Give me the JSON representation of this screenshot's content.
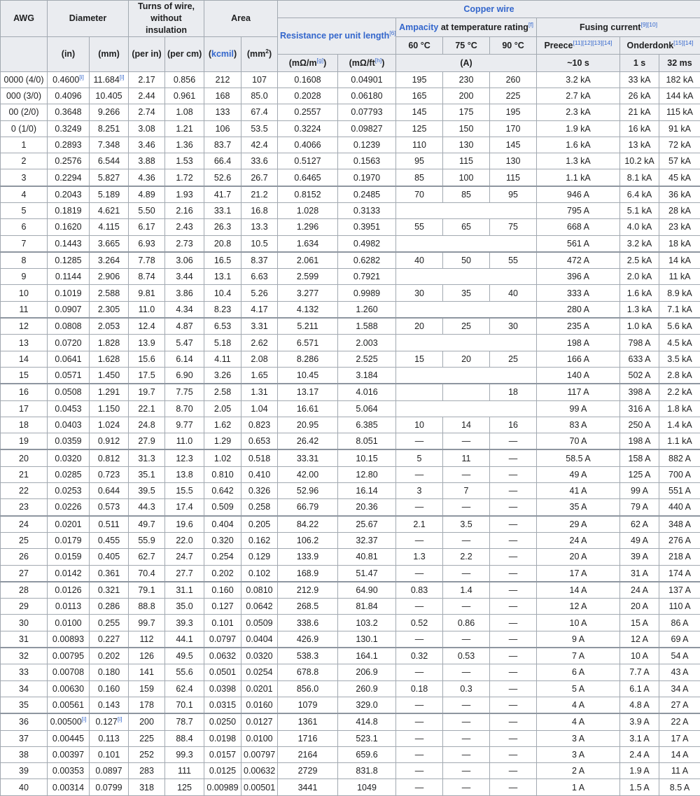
{
  "header": {
    "awg": "AWG",
    "diameter": "Diameter",
    "turns": "Turns of wire, without insulation",
    "area": "Area",
    "copper_wire": "Copper wire",
    "resistance": "Resistance per unit length",
    "resistance_ref": "[6]",
    "ampacity_link": "Ampacity",
    "ampacity_rest": " at temperature rating",
    "ampacity_ref": "[f]",
    "fusing": "Fusing current",
    "fusing_ref": "[9][10]",
    "t60": "60 °C",
    "t75": "75 °C",
    "t90": "90 °C",
    "preece": "Preece",
    "preece_ref": "[11][12][13][14]",
    "onderdonk": "Onderdonk",
    "onderdonk_ref": "[15][14]",
    "u_in": "(in)",
    "u_mm": "(mm)",
    "u_per_in": "(per in)",
    "u_per_cm": "(per cm)",
    "u_kcmil_open": "(",
    "u_kcmil": "kcmil",
    "u_kcmil_close": ")",
    "u_mm2_base": "(mm",
    "u_mm2_sup": "2",
    "u_mm2_close": ")",
    "u_mohm_m": "(mΩ/m",
    "u_mohm_m_ref": "[g]",
    "u_mohm_ft": "(mΩ/ft",
    "u_mohm_ft_ref": "[h]",
    "u_amp": "(A)",
    "u_10s": "~10 s",
    "u_1s": "1 s",
    "u_32ms": "32 ms",
    "close_paren": ")"
  },
  "rows": [
    {
      "awg": "0000 (4/0)",
      "din": "0.4600",
      "din_ref": "[i]",
      "dmm": "11.684",
      "dmm_ref": "[i]",
      "tin": "2.17",
      "tcm": "0.856",
      "kcmil": "212",
      "mm2": "107",
      "rm": "0.1608",
      "rft": "0.04901",
      "amp": [
        "195",
        "230",
        "260"
      ],
      "preece": "3.2 kA",
      "o1": "33 kA",
      "o32": "182 kA"
    },
    {
      "awg": "000 (3/0)",
      "din": "0.4096",
      "dmm": "10.405",
      "tin": "2.44",
      "tcm": "0.961",
      "kcmil": "168",
      "mm2": "85.0",
      "rm": "0.2028",
      "rft": "0.06180",
      "amp": [
        "165",
        "200",
        "225"
      ],
      "preece": "2.7 kA",
      "o1": "26 kA",
      "o32": "144 kA"
    },
    {
      "awg": "00 (2/0)",
      "din": "0.3648",
      "dmm": "9.266",
      "tin": "2.74",
      "tcm": "1.08",
      "kcmil": "133",
      "mm2": "67.4",
      "rm": "0.2557",
      "rft": "0.07793",
      "amp": [
        "145",
        "175",
        "195"
      ],
      "preece": "2.3 kA",
      "o1": "21 kA",
      "o32": "115 kA"
    },
    {
      "awg": "0 (1/0)",
      "din": "0.3249",
      "dmm": "8.251",
      "tin": "3.08",
      "tcm": "1.21",
      "kcmil": "106",
      "mm2": "53.5",
      "rm": "0.3224",
      "rft": "0.09827",
      "amp": [
        "125",
        "150",
        "170"
      ],
      "preece": "1.9 kA",
      "o1": "16 kA",
      "o32": "91 kA"
    },
    {
      "awg": "1",
      "din": "0.2893",
      "dmm": "7.348",
      "tin": "3.46",
      "tcm": "1.36",
      "kcmil": "83.7",
      "mm2": "42.4",
      "rm": "0.4066",
      "rft": "0.1239",
      "amp": [
        "110",
        "130",
        "145"
      ],
      "preece": "1.6 kA",
      "o1": "13 kA",
      "o32": "72 kA"
    },
    {
      "awg": "2",
      "din": "0.2576",
      "dmm": "6.544",
      "tin": "3.88",
      "tcm": "1.53",
      "kcmil": "66.4",
      "mm2": "33.6",
      "rm": "0.5127",
      "rft": "0.1563",
      "amp": [
        "95",
        "115",
        "130"
      ],
      "preece": "1.3 kA",
      "o1": "10.2 kA",
      "o32": "57 kA"
    },
    {
      "awg": "3",
      "din": "0.2294",
      "dmm": "5.827",
      "tin": "4.36",
      "tcm": "1.72",
      "kcmil": "52.6",
      "mm2": "26.7",
      "rm": "0.6465",
      "rft": "0.1970",
      "amp": [
        "85",
        "100",
        "115"
      ],
      "preece": "1.1 kA",
      "o1": "8.1 kA",
      "o32": "45 kA"
    },
    {
      "awg": "4",
      "din": "0.2043",
      "dmm": "5.189",
      "tin": "4.89",
      "tcm": "1.93",
      "kcmil": "41.7",
      "mm2": "21.2",
      "rm": "0.8152",
      "rft": "0.2485",
      "amp": [
        "70",
        "85",
        "95"
      ],
      "preece": "946 A",
      "o1": "6.4 kA",
      "o32": "36 kA"
    },
    {
      "awg": "5",
      "din": "0.1819",
      "dmm": "4.621",
      "tin": "5.50",
      "tcm": "2.16",
      "kcmil": "33.1",
      "mm2": "16.8",
      "rm": "1.028",
      "rft": "0.3133",
      "amp": null,
      "preece": "795 A",
      "o1": "5.1 kA",
      "o32": "28 kA"
    },
    {
      "awg": "6",
      "din": "0.1620",
      "dmm": "4.115",
      "tin": "6.17",
      "tcm": "2.43",
      "kcmil": "26.3",
      "mm2": "13.3",
      "rm": "1.296",
      "rft": "0.3951",
      "amp": [
        "55",
        "65",
        "75"
      ],
      "preece": "668 A",
      "o1": "4.0 kA",
      "o32": "23 kA"
    },
    {
      "awg": "7",
      "din": "0.1443",
      "dmm": "3.665",
      "tin": "6.93",
      "tcm": "2.73",
      "kcmil": "20.8",
      "mm2": "10.5",
      "rm": "1.634",
      "rft": "0.4982",
      "amp": null,
      "preece": "561 A",
      "o1": "3.2 kA",
      "o32": "18 kA"
    },
    {
      "awg": "8",
      "din": "0.1285",
      "dmm": "3.264",
      "tin": "7.78",
      "tcm": "3.06",
      "kcmil": "16.5",
      "mm2": "8.37",
      "rm": "2.061",
      "rft": "0.6282",
      "amp": [
        "40",
        "50",
        "55"
      ],
      "preece": "472 A",
      "o1": "2.5 kA",
      "o32": "14 kA"
    },
    {
      "awg": "9",
      "din": "0.1144",
      "dmm": "2.906",
      "tin": "8.74",
      "tcm": "3.44",
      "kcmil": "13.1",
      "mm2": "6.63",
      "rm": "2.599",
      "rft": "0.7921",
      "amp": null,
      "preece": "396 A",
      "o1": "2.0 kA",
      "o32": "11 kA"
    },
    {
      "awg": "10",
      "din": "0.1019",
      "dmm": "2.588",
      "tin": "9.81",
      "tcm": "3.86",
      "kcmil": "10.4",
      "mm2": "5.26",
      "rm": "3.277",
      "rft": "0.9989",
      "amp": [
        "30",
        "35",
        "40"
      ],
      "preece": "333 A",
      "o1": "1.6 kA",
      "o32": "8.9 kA"
    },
    {
      "awg": "11",
      "din": "0.0907",
      "dmm": "2.305",
      "tin": "11.0",
      "tcm": "4.34",
      "kcmil": "8.23",
      "mm2": "4.17",
      "rm": "4.132",
      "rft": "1.260",
      "amp": null,
      "preece": "280 A",
      "o1": "1.3 kA",
      "o32": "7.1 kA"
    },
    {
      "awg": "12",
      "din": "0.0808",
      "dmm": "2.053",
      "tin": "12.4",
      "tcm": "4.87",
      "kcmil": "6.53",
      "mm2": "3.31",
      "rm": "5.211",
      "rft": "1.588",
      "amp": [
        "20",
        "25",
        "30"
      ],
      "preece": "235 A",
      "o1": "1.0 kA",
      "o32": "5.6 kA"
    },
    {
      "awg": "13",
      "din": "0.0720",
      "dmm": "1.828",
      "tin": "13.9",
      "tcm": "5.47",
      "kcmil": "5.18",
      "mm2": "2.62",
      "rm": "6.571",
      "rft": "2.003",
      "amp": null,
      "preece": "198 A",
      "o1": "798 A",
      "o32": "4.5 kA"
    },
    {
      "awg": "14",
      "din": "0.0641",
      "dmm": "1.628",
      "tin": "15.6",
      "tcm": "6.14",
      "kcmil": "4.11",
      "mm2": "2.08",
      "rm": "8.286",
      "rft": "2.525",
      "amp": [
        "15",
        "20",
        "25"
      ],
      "preece": "166 A",
      "o1": "633 A",
      "o32": "3.5 kA"
    },
    {
      "awg": "15",
      "din": "0.0571",
      "dmm": "1.450",
      "tin": "17.5",
      "tcm": "6.90",
      "kcmil": "3.26",
      "mm2": "1.65",
      "rm": "10.45",
      "rft": "3.184",
      "amp": null,
      "preece": "140 A",
      "o1": "502 A",
      "o32": "2.8 kA"
    },
    {
      "awg": "16",
      "din": "0.0508",
      "dmm": "1.291",
      "tin": "19.7",
      "tcm": "7.75",
      "kcmil": "2.58",
      "mm2": "1.31",
      "rm": "13.17",
      "rft": "4.016",
      "amp": [
        "",
        "",
        "18"
      ],
      "preece": "117 A",
      "o1": "398 A",
      "o32": "2.2 kA"
    },
    {
      "awg": "17",
      "din": "0.0453",
      "dmm": "1.150",
      "tin": "22.1",
      "tcm": "8.70",
      "kcmil": "2.05",
      "mm2": "1.04",
      "rm": "16.61",
      "rft": "5.064",
      "amp": null,
      "preece": "99 A",
      "o1": "316 A",
      "o32": "1.8 kA"
    },
    {
      "awg": "18",
      "din": "0.0403",
      "dmm": "1.024",
      "tin": "24.8",
      "tcm": "9.77",
      "kcmil": "1.62",
      "mm2": "0.823",
      "rm": "20.95",
      "rft": "6.385",
      "amp": [
        "10",
        "14",
        "16"
      ],
      "preece": "83 A",
      "o1": "250 A",
      "o32": "1.4 kA"
    },
    {
      "awg": "19",
      "din": "0.0359",
      "dmm": "0.912",
      "tin": "27.9",
      "tcm": "11.0",
      "kcmil": "1.29",
      "mm2": "0.653",
      "rm": "26.42",
      "rft": "8.051",
      "amp": [
        "—",
        "—",
        "—"
      ],
      "preece": "70 A",
      "o1": "198 A",
      "o32": "1.1 kA"
    },
    {
      "awg": "20",
      "din": "0.0320",
      "dmm": "0.812",
      "tin": "31.3",
      "tcm": "12.3",
      "kcmil": "1.02",
      "mm2": "0.518",
      "rm": "33.31",
      "rft": "10.15",
      "amp": [
        "5",
        "11",
        "—"
      ],
      "preece": "58.5 A",
      "o1": "158 A",
      "o32": "882 A"
    },
    {
      "awg": "21",
      "din": "0.0285",
      "dmm": "0.723",
      "tin": "35.1",
      "tcm": "13.8",
      "kcmil": "0.810",
      "mm2": "0.410",
      "rm": "42.00",
      "rft": "12.80",
      "amp": [
        "—",
        "—",
        "—"
      ],
      "preece": "49 A",
      "o1": "125 A",
      "o32": "700 A"
    },
    {
      "awg": "22",
      "din": "0.0253",
      "dmm": "0.644",
      "tin": "39.5",
      "tcm": "15.5",
      "kcmil": "0.642",
      "mm2": "0.326",
      "rm": "52.96",
      "rft": "16.14",
      "amp": [
        "3",
        "7",
        "—"
      ],
      "preece": "41 A",
      "o1": "99 A",
      "o32": "551 A"
    },
    {
      "awg": "23",
      "din": "0.0226",
      "dmm": "0.573",
      "tin": "44.3",
      "tcm": "17.4",
      "kcmil": "0.509",
      "mm2": "0.258",
      "rm": "66.79",
      "rft": "20.36",
      "amp": [
        "—",
        "—",
        "—"
      ],
      "preece": "35 A",
      "o1": "79 A",
      "o32": "440 A"
    },
    {
      "awg": "24",
      "din": "0.0201",
      "dmm": "0.511",
      "tin": "49.7",
      "tcm": "19.6",
      "kcmil": "0.404",
      "mm2": "0.205",
      "rm": "84.22",
      "rft": "25.67",
      "amp": [
        "2.1",
        "3.5",
        "—"
      ],
      "preece": "29 A",
      "o1": "62 A",
      "o32": "348 A"
    },
    {
      "awg": "25",
      "din": "0.0179",
      "dmm": "0.455",
      "tin": "55.9",
      "tcm": "22.0",
      "kcmil": "0.320",
      "mm2": "0.162",
      "rm": "106.2",
      "rft": "32.37",
      "amp": [
        "—",
        "—",
        "—"
      ],
      "preece": "24 A",
      "o1": "49 A",
      "o32": "276 A"
    },
    {
      "awg": "26",
      "din": "0.0159",
      "dmm": "0.405",
      "tin": "62.7",
      "tcm": "24.7",
      "kcmil": "0.254",
      "mm2": "0.129",
      "rm": "133.9",
      "rft": "40.81",
      "amp": [
        "1.3",
        "2.2",
        "—"
      ],
      "preece": "20 A",
      "o1": "39 A",
      "o32": "218 A"
    },
    {
      "awg": "27",
      "din": "0.0142",
      "dmm": "0.361",
      "tin": "70.4",
      "tcm": "27.7",
      "kcmil": "0.202",
      "mm2": "0.102",
      "rm": "168.9",
      "rft": "51.47",
      "amp": [
        "—",
        "—",
        "—"
      ],
      "preece": "17 A",
      "o1": "31 A",
      "o32": "174 A"
    },
    {
      "awg": "28",
      "din": "0.0126",
      "dmm": "0.321",
      "tin": "79.1",
      "tcm": "31.1",
      "kcmil": "0.160",
      "mm2": "0.0810",
      "rm": "212.9",
      "rft": "64.90",
      "amp": [
        "0.83",
        "1.4",
        "—"
      ],
      "preece": "14 A",
      "o1": "24 A",
      "o32": "137 A"
    },
    {
      "awg": "29",
      "din": "0.0113",
      "dmm": "0.286",
      "tin": "88.8",
      "tcm": "35.0",
      "kcmil": "0.127",
      "mm2": "0.0642",
      "rm": "268.5",
      "rft": "81.84",
      "amp": [
        "—",
        "—",
        "—"
      ],
      "preece": "12 A",
      "o1": "20 A",
      "o32": "110 A"
    },
    {
      "awg": "30",
      "din": "0.0100",
      "dmm": "0.255",
      "tin": "99.7",
      "tcm": "39.3",
      "kcmil": "0.101",
      "mm2": "0.0509",
      "rm": "338.6",
      "rft": "103.2",
      "amp": [
        "0.52",
        "0.86",
        "—"
      ],
      "preece": "10 A",
      "o1": "15 A",
      "o32": "86 A"
    },
    {
      "awg": "31",
      "din": "0.00893",
      "dmm": "0.227",
      "tin": "112",
      "tcm": "44.1",
      "kcmil": "0.0797",
      "mm2": "0.0404",
      "rm": "426.9",
      "rft": "130.1",
      "amp": [
        "—",
        "—",
        "—"
      ],
      "preece": "9 A",
      "o1": "12 A",
      "o32": "69 A"
    },
    {
      "awg": "32",
      "din": "0.00795",
      "dmm": "0.202",
      "tin": "126",
      "tcm": "49.5",
      "kcmil": "0.0632",
      "mm2": "0.0320",
      "rm": "538.3",
      "rft": "164.1",
      "amp": [
        "0.32",
        "0.53",
        "—"
      ],
      "preece": "7 A",
      "o1": "10 A",
      "o32": "54 A"
    },
    {
      "awg": "33",
      "din": "0.00708",
      "dmm": "0.180",
      "tin": "141",
      "tcm": "55.6",
      "kcmil": "0.0501",
      "mm2": "0.0254",
      "rm": "678.8",
      "rft": "206.9",
      "amp": [
        "—",
        "—",
        "—"
      ],
      "preece": "6 A",
      "o1": "7.7 A",
      "o32": "43 A"
    },
    {
      "awg": "34",
      "din": "0.00630",
      "dmm": "0.160",
      "tin": "159",
      "tcm": "62.4",
      "kcmil": "0.0398",
      "mm2": "0.0201",
      "rm": "856.0",
      "rft": "260.9",
      "amp": [
        "0.18",
        "0.3",
        "—"
      ],
      "preece": "5 A",
      "o1": "6.1 A",
      "o32": "34 A"
    },
    {
      "awg": "35",
      "din": "0.00561",
      "dmm": "0.143",
      "tin": "178",
      "tcm": "70.1",
      "kcmil": "0.0315",
      "mm2": "0.0160",
      "rm": "1079",
      "rft": "329.0",
      "amp": [
        "—",
        "—",
        "—"
      ],
      "preece": "4 A",
      "o1": "4.8 A",
      "o32": "27 A"
    },
    {
      "awg": "36",
      "din": "0.00500",
      "din_ref": "[i]",
      "dmm": "0.127",
      "dmm_ref": "[i]",
      "tin": "200",
      "tcm": "78.7",
      "kcmil": "0.0250",
      "mm2": "0.0127",
      "rm": "1361",
      "rft": "414.8",
      "amp": [
        "—",
        "—",
        "—"
      ],
      "preece": "4 A",
      "o1": "3.9 A",
      "o32": "22 A"
    },
    {
      "awg": "37",
      "din": "0.00445",
      "dmm": "0.113",
      "tin": "225",
      "tcm": "88.4",
      "kcmil": "0.0198",
      "mm2": "0.0100",
      "rm": "1716",
      "rft": "523.1",
      "amp": [
        "—",
        "—",
        "—"
      ],
      "preece": "3 A",
      "o1": "3.1 A",
      "o32": "17 A"
    },
    {
      "awg": "38",
      "din": "0.00397",
      "dmm": "0.101",
      "tin": "252",
      "tcm": "99.3",
      "kcmil": "0.0157",
      "mm2": "0.00797",
      "rm": "2164",
      "rft": "659.6",
      "amp": [
        "—",
        "—",
        "—"
      ],
      "preece": "3 A",
      "o1": "2.4 A",
      "o32": "14 A"
    },
    {
      "awg": "39",
      "din": "0.00353",
      "dmm": "0.0897",
      "tin": "283",
      "tcm": "111",
      "kcmil": "0.0125",
      "mm2": "0.00632",
      "rm": "2729",
      "rft": "831.8",
      "amp": [
        "—",
        "—",
        "—"
      ],
      "preece": "2 A",
      "o1": "1.9 A",
      "o32": "11 A"
    },
    {
      "awg": "40",
      "din": "0.00314",
      "dmm": "0.0799",
      "tin": "318",
      "tcm": "125",
      "kcmil": "0.00989",
      "mm2": "0.00501",
      "rm": "3441",
      "rft": "1049",
      "amp": [
        "—",
        "—",
        "—"
      ],
      "preece": "1 A",
      "o1": "1.5 A",
      "o32": "8.5 A"
    }
  ]
}
